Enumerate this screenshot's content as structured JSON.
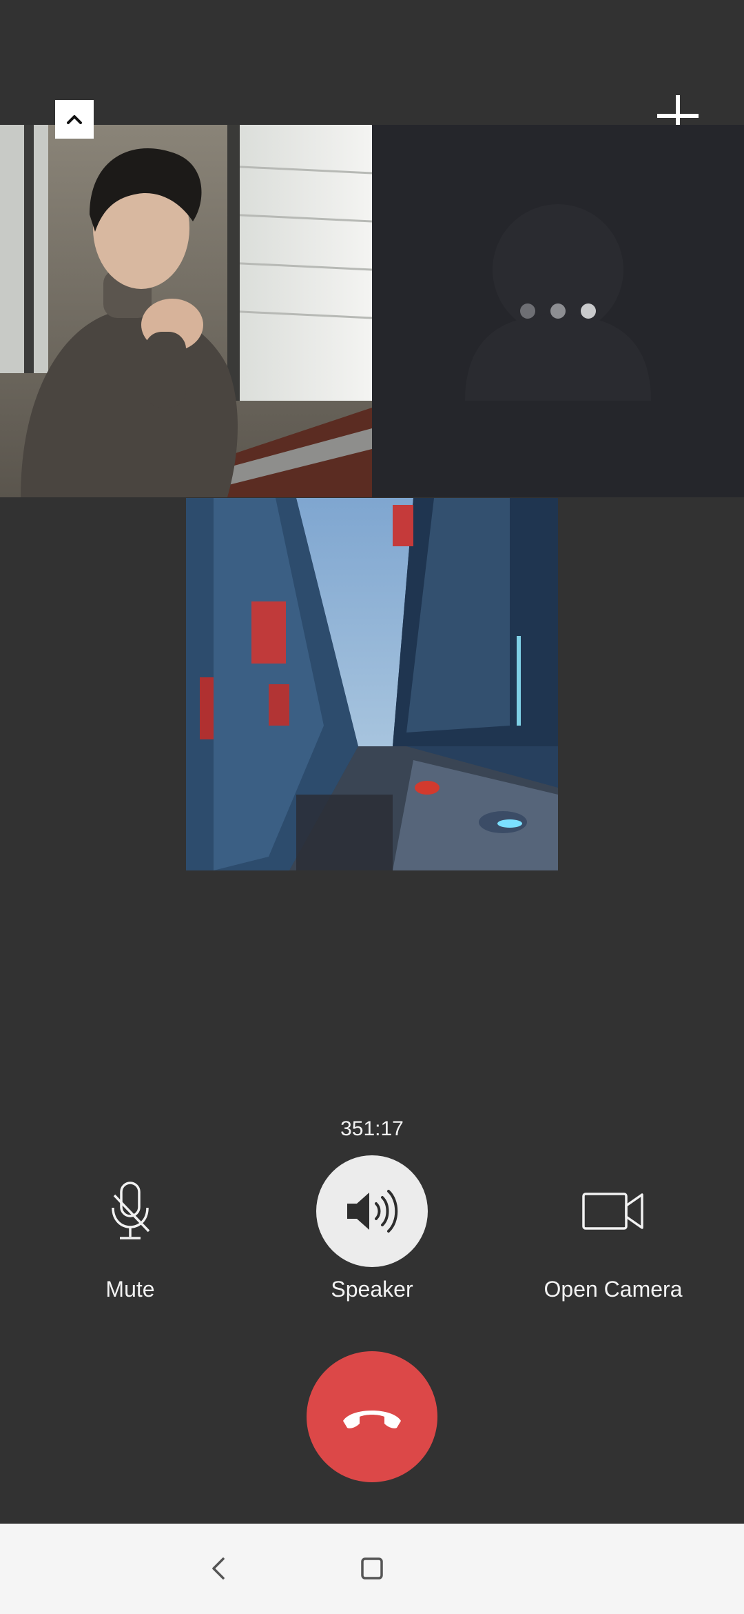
{
  "call": {
    "timer": "351:17"
  },
  "controls": {
    "mute_label": "Mute",
    "speaker_label": "Speaker",
    "camera_label": "Open Camera"
  },
  "colors": {
    "background": "#323232",
    "hangup": "#dc4848",
    "speaker_active": "#ececec",
    "navbar": "#f5f5f5"
  },
  "icons": {
    "collapse": "chevron-up-icon",
    "add": "plus-icon",
    "mute": "microphone-off-icon",
    "speaker": "speaker-icon",
    "camera": "video-camera-icon",
    "hangup": "phone-hangup-icon",
    "back": "chevron-left-icon",
    "home": "square-icon"
  },
  "participants": [
    {
      "state": "video",
      "content": "man in grey turtleneck by window"
    },
    {
      "state": "connecting"
    },
    {
      "state": "video",
      "content": "futuristic city street"
    }
  ]
}
